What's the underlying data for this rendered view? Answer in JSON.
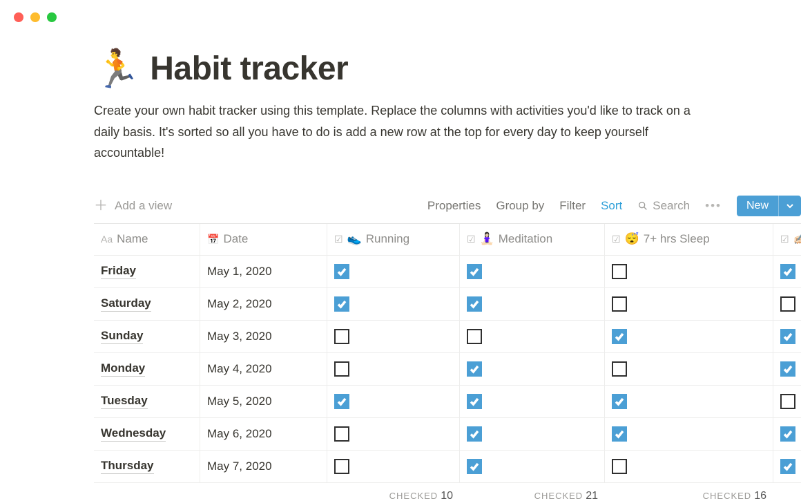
{
  "page": {
    "emoji": "🏃",
    "title": "Habit tracker",
    "description": "Create your own habit tracker using this template. Replace the columns with activities you'd like to track on a daily basis. It's sorted so all you have to do is add a new row at the top for every day to keep yourself accountable!"
  },
  "toolbar": {
    "add_view": "Add a view",
    "properties": "Properties",
    "group_by": "Group by",
    "filter": "Filter",
    "sort": "Sort",
    "search": "Search",
    "new": "New"
  },
  "columns": {
    "name": "Name",
    "date": "Date",
    "running_emoji": "👟",
    "running": "Running",
    "meditation_emoji": "🧘🏻‍♀️",
    "meditation": "Meditation",
    "sleep_emoji": "😴",
    "sleep": "7+ hrs Sleep",
    "write_emoji": "✍🏻"
  },
  "rows": [
    {
      "name": "Friday",
      "date": "May 1, 2020",
      "running": true,
      "meditation": true,
      "sleep": false,
      "write": true
    },
    {
      "name": "Saturday",
      "date": "May 2, 2020",
      "running": true,
      "meditation": true,
      "sleep": false,
      "write": false
    },
    {
      "name": "Sunday",
      "date": "May 3, 2020",
      "running": false,
      "meditation": false,
      "sleep": true,
      "write": true
    },
    {
      "name": "Monday",
      "date": "May 4, 2020",
      "running": false,
      "meditation": true,
      "sleep": false,
      "write": true
    },
    {
      "name": "Tuesday",
      "date": "May 5, 2020",
      "running": true,
      "meditation": true,
      "sleep": true,
      "write": false
    },
    {
      "name": "Wednesday",
      "date": "May 6, 2020",
      "running": false,
      "meditation": true,
      "sleep": true,
      "write": true
    },
    {
      "name": "Thursday",
      "date": "May 7, 2020",
      "running": false,
      "meditation": true,
      "sleep": false,
      "write": true
    }
  ],
  "footer": {
    "label": "CHECKED",
    "running": "10",
    "meditation": "21",
    "sleep": "16"
  }
}
